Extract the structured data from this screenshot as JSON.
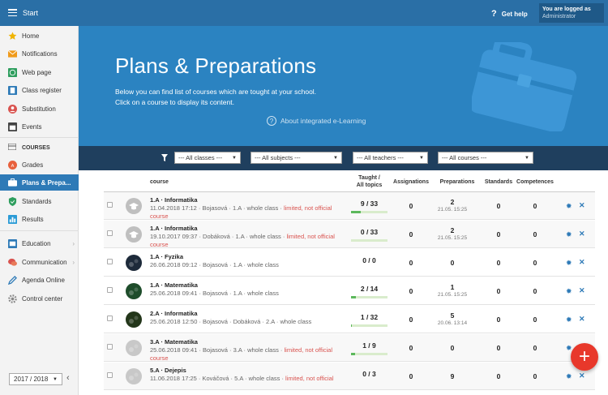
{
  "topbar": {
    "start": "Start",
    "help": "Get help",
    "logged_line": "You are logged as",
    "user_role": "Administrator"
  },
  "sidebar": {
    "items": [
      {
        "label": "Home",
        "icon": "star-icon"
      },
      {
        "label": "Notifications",
        "icon": "envelope-icon"
      },
      {
        "label": "Web page",
        "icon": "globe-icon"
      },
      {
        "label": "Class register",
        "icon": "book-icon"
      },
      {
        "label": "Substitution",
        "icon": "person-icon"
      },
      {
        "label": "Events",
        "icon": "calendar-icon"
      }
    ],
    "courses_section": "COURSES",
    "course_items": [
      {
        "label": "Grades",
        "icon": "grades-icon"
      },
      {
        "label": "Plans & Prepa...",
        "icon": "briefcase-icon"
      },
      {
        "label": "Standards",
        "icon": "shield-check-icon"
      },
      {
        "label": "Results",
        "icon": "bar-chart-icon"
      }
    ],
    "bottom_items": [
      {
        "label": "Education",
        "icon": "education-icon"
      },
      {
        "label": "Communication",
        "icon": "chat-icon"
      },
      {
        "label": "Agenda Online",
        "icon": "pen-icon"
      },
      {
        "label": "Control center",
        "icon": "gear-icon"
      }
    ],
    "year": "2017 / 2018"
  },
  "hero": {
    "title": "Plans & Preparations",
    "desc": "Below you can find list of courses which are tought at your school. Click on a course to display its content.",
    "about": "About integrated e-Learning"
  },
  "filters": {
    "classes": "--- All classes ---",
    "subjects": "--- All subjects ---",
    "teachers": "--- All teachers ---",
    "courses": "--- All courses ---"
  },
  "table": {
    "headers": {
      "course": "course",
      "taught1": "Taught /",
      "taught2": "All topics",
      "assign": "Assignations",
      "prep": "Preparations",
      "std": "Standards",
      "comp": "Competences"
    },
    "rows": [
      {
        "name": "1.A · Informatika",
        "details": "11.04.2018 17:12 · Bojasová · 1.A · whole class · ",
        "limited": "limited, not official course",
        "taught": "9 / 33",
        "progress": 0.27,
        "assign": "0",
        "prep": "2",
        "prep_date": "21.05. 15:25",
        "std": "0",
        "comp": "0"
      },
      {
        "name": "1.A · Informatika",
        "details": "19.10.2017 09:37 · Dobáková · 1.A · whole class · ",
        "limited": "limited, not official course",
        "taught": "0 / 33",
        "progress": 0.0,
        "assign": "0",
        "prep": "2",
        "prep_date": "21.05. 15:25",
        "std": "0",
        "comp": "0"
      },
      {
        "name": "1.A · Fyzika",
        "details": "26.06.2018 09:12 · Bojasová · 1.A · whole class",
        "limited": "",
        "taught": "0 / 0",
        "progress": null,
        "assign": "0",
        "prep": "0",
        "prep_date": "",
        "std": "0",
        "comp": "0"
      },
      {
        "name": "1.A · Matematika",
        "details": "25.06.2018 09:41 · Bojasová · 1.A · whole class",
        "limited": "",
        "taught": "2 / 14",
        "progress": 0.14,
        "assign": "0",
        "prep": "1",
        "prep_date": "21.05. 15:25",
        "std": "0",
        "comp": "0"
      },
      {
        "name": "2.A · Informatika",
        "details": "25.06.2018 12:50 · Bojasová · Dobáková · 2.A · whole class",
        "limited": "",
        "taught": "1 / 32",
        "progress": 0.03,
        "assign": "0",
        "prep": "5",
        "prep_date": "20.06. 13:14",
        "std": "0",
        "comp": "0"
      },
      {
        "name": "3.A · Matematika",
        "details": "25.06.2018 09:41 · Bojasová · 3.A · whole class · ",
        "limited": "limited, not official course",
        "taught": "1 / 9",
        "progress": 0.11,
        "assign": "0",
        "prep": "0",
        "prep_date": "",
        "std": "0",
        "comp": "0"
      },
      {
        "name": "5.A · Dejepis",
        "details": "11.06.2018 17:25 · Kováčová · 5.A · whole class · ",
        "limited": "limited, not official",
        "taught": "0 / 3",
        "progress": null,
        "assign": "0",
        "prep": "9",
        "prep_date": "",
        "std": "0",
        "comp": "0"
      }
    ]
  },
  "colors": {
    "brand": "#2a6fa6",
    "hero": "#2b83c1",
    "filterbar": "#1f3f5e",
    "fab": "#e8382b"
  }
}
